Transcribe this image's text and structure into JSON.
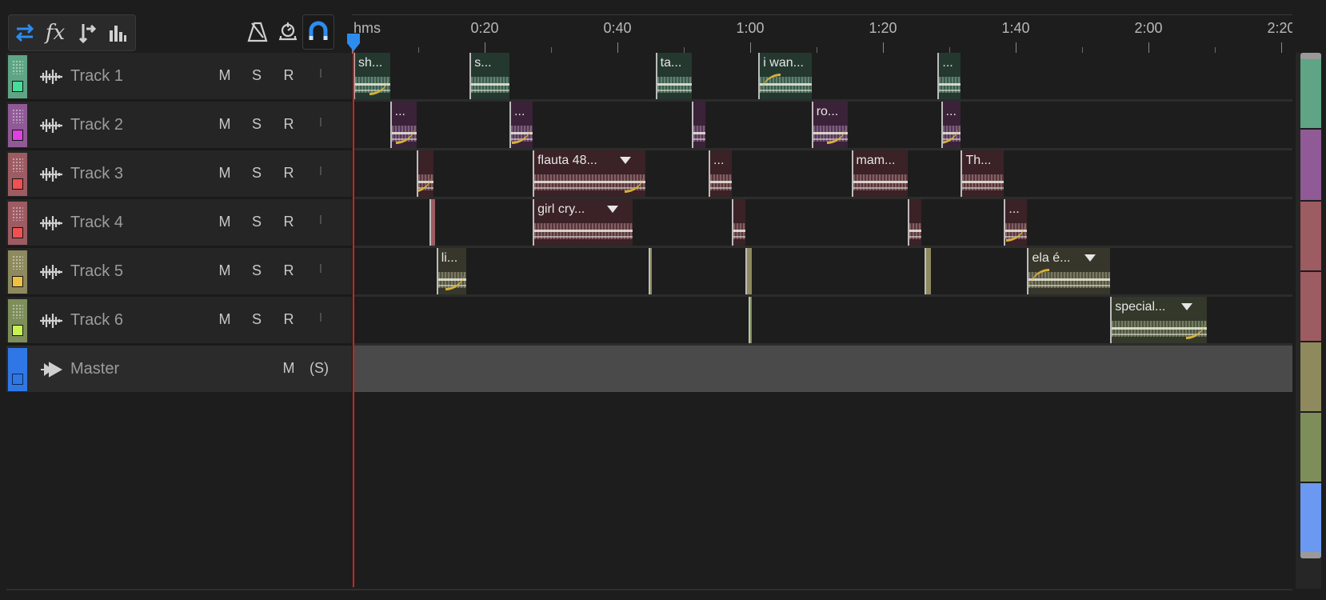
{
  "toolbar": {
    "left_buttons": [
      {
        "name": "switch-view-icon",
        "color": "#2d8cf0"
      },
      {
        "name": "fx-icon",
        "label": "fx"
      },
      {
        "name": "sends-icon"
      },
      {
        "name": "eq-bars-icon"
      }
    ],
    "right_buttons": [
      {
        "name": "metronome-icon"
      },
      {
        "name": "auto-scroll-icon"
      },
      {
        "name": "snap-magnet-icon",
        "active": true,
        "color": "#2d8cf0"
      }
    ]
  },
  "ruler": {
    "format_label": "hms",
    "ticks": [
      "0:20",
      "0:40",
      "1:00",
      "1:20",
      "1:40",
      "2:00",
      "2:20"
    ]
  },
  "tracks": [
    {
      "name": "Track 1",
      "color": "#5fa585",
      "check_color": "#44dd99",
      "buttons": [
        "M",
        "S",
        "R",
        "I"
      ]
    },
    {
      "name": "Track 2",
      "color": "#8f5a96",
      "check_color": "#e040e0",
      "buttons": [
        "M",
        "S",
        "R",
        "I"
      ]
    },
    {
      "name": "Track 3",
      "color": "#9d5b62",
      "check_color": "#f05050",
      "buttons": [
        "M",
        "S",
        "R",
        "I"
      ]
    },
    {
      "name": "Track 4",
      "color": "#9d5b62",
      "check_color": "#f05050",
      "buttons": [
        "M",
        "S",
        "R",
        "I"
      ]
    },
    {
      "name": "Track 5",
      "color": "#8e8a5e",
      "check_color": "#f0c040",
      "buttons": [
        "M",
        "S",
        "R",
        "I"
      ]
    },
    {
      "name": "Track 6",
      "color": "#7e8e5a",
      "check_color": "#c8f050",
      "buttons": [
        "M",
        "S",
        "R",
        "I"
      ]
    }
  ],
  "master": {
    "name": "Master",
    "buttons": [
      "M",
      "(S)"
    ],
    "color": "#2f77e6"
  },
  "clips": [
    [
      {
        "label": "sh...",
        "start": 0.0,
        "end": 5.5,
        "fade_out": true
      },
      {
        "label": "s...",
        "start": 17.5,
        "end": 23.5
      },
      {
        "label": "ta...",
        "start": 45.5,
        "end": 51.0
      },
      {
        "label": "i wan...",
        "start": 61.0,
        "end": 69.0,
        "fade_in": true
      },
      {
        "label": "...",
        "start": 88.0,
        "end": 91.5
      }
    ],
    [
      {
        "label": "...",
        "start": 5.5,
        "end": 9.5,
        "fade_out": true
      },
      {
        "label": "...",
        "start": 23.5,
        "end": 27.0,
        "fade_out": true
      },
      {
        "label": "",
        "start": 51.0,
        "end": 53.0
      },
      {
        "label": "ro...",
        "start": 69.0,
        "end": 74.5,
        "fade_out": true
      },
      {
        "label": "...",
        "start": 88.5,
        "end": 91.5,
        "fade_out": true
      }
    ],
    [
      {
        "label": "",
        "start": 9.5,
        "end": 12.0,
        "fade_out": true
      },
      {
        "label": "flauta 48...",
        "start": 27.0,
        "end": 44.0,
        "fade_out": true,
        "menu": true
      },
      {
        "label": "...",
        "start": 53.5,
        "end": 57.0
      },
      {
        "label": "mam...",
        "start": 75.0,
        "end": 83.5
      },
      {
        "label": "Th...",
        "start": 91.5,
        "end": 98.0
      }
    ],
    [
      {
        "label": "",
        "start": 11.5,
        "end": 12.3
      },
      {
        "label": "girl cry...",
        "start": 27.0,
        "end": 42.0,
        "menu": true
      },
      {
        "label": "",
        "start": 57.0,
        "end": 59.0
      },
      {
        "label": "",
        "start": 83.5,
        "end": 85.5
      },
      {
        "label": "...",
        "start": 98.0,
        "end": 101.5,
        "fade_out": true
      }
    ],
    [
      {
        "label": "li...",
        "start": 12.5,
        "end": 17.0,
        "fade_out": true
      },
      {
        "label": "",
        "start": 44.5,
        "end": 45.0
      },
      {
        "label": "",
        "start": 59.0,
        "end": 60.0
      },
      {
        "label": "",
        "start": 86.0,
        "end": 87.0
      },
      {
        "label": "ela é...",
        "start": 101.5,
        "end": 114.0,
        "fade_in": true,
        "menu": true
      }
    ],
    [
      {
        "label": "",
        "start": 59.5,
        "end": 60.0
      },
      {
        "label": "special...",
        "start": 114.0,
        "end": 128.5,
        "fade_out": true,
        "menu": true
      }
    ]
  ],
  "scrollbar_segments": [
    {
      "color": "#5fa585"
    },
    {
      "color": "#8f5a96"
    },
    {
      "color": "#9d5b62"
    },
    {
      "color": "#9d5b62"
    },
    {
      "color": "#8e8a5e"
    },
    {
      "color": "#7e8e5a"
    },
    {
      "color": "#6b98f0"
    }
  ]
}
